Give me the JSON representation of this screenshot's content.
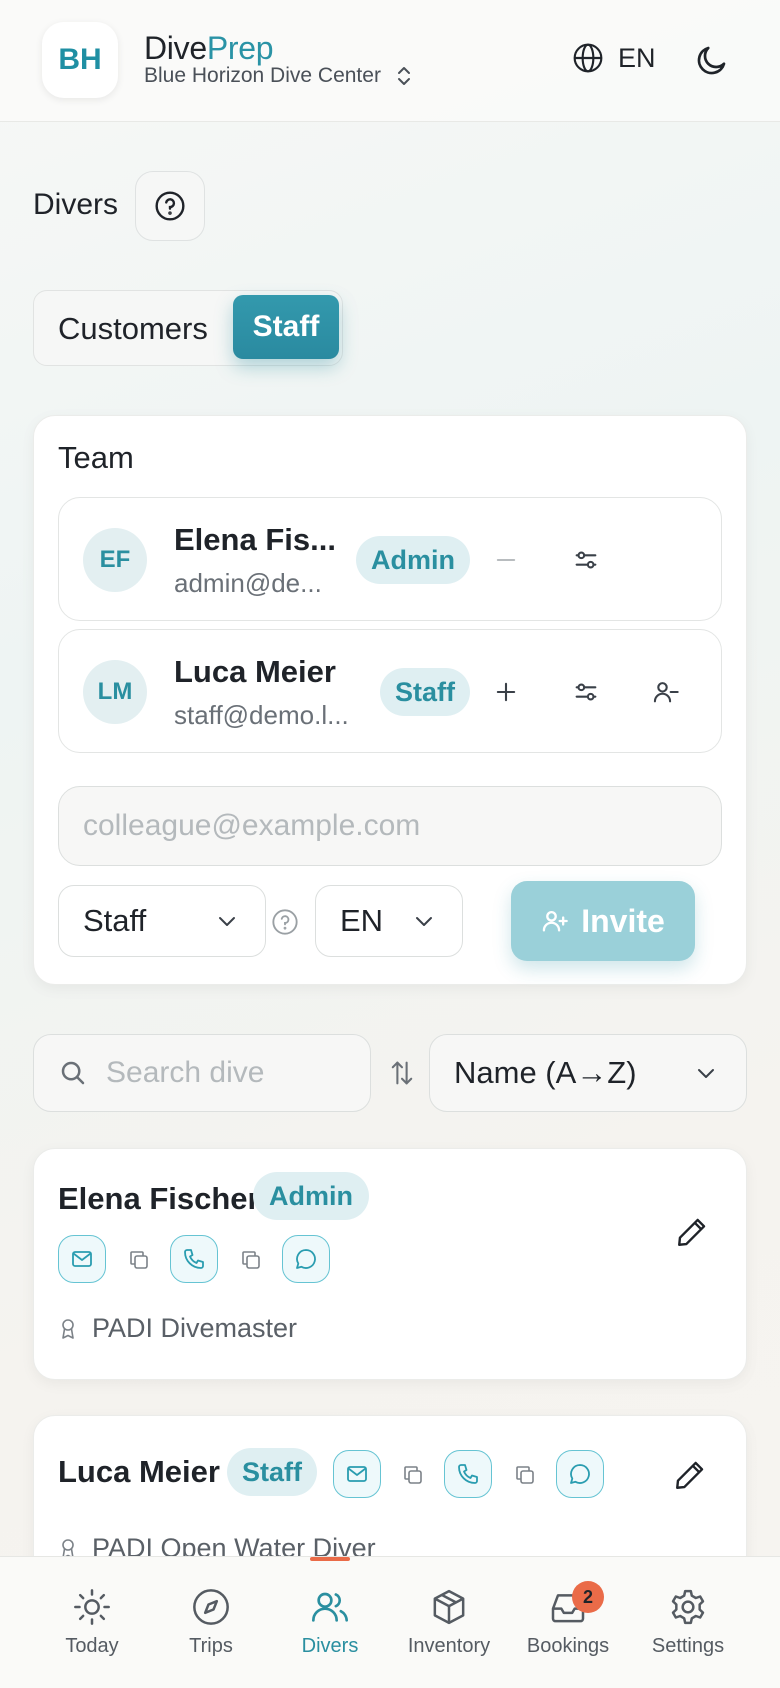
{
  "header": {
    "logo_initials": "BH",
    "brand_part1": "Dive",
    "brand_part2": "Prep",
    "center_name": "Blue Horizon Dive Center",
    "language": "EN"
  },
  "page": {
    "title": "Divers"
  },
  "segments": {
    "customers": "Customers",
    "staff": "Staff",
    "selected": "Staff"
  },
  "team": {
    "title": "Team",
    "members": [
      {
        "initials": "EF",
        "name": "Elena Fis...",
        "email": "admin@de...",
        "role": "Admin"
      },
      {
        "initials": "LM",
        "name": "Luca Meier",
        "email": "staff@demo.l...",
        "role": "Staff"
      }
    ],
    "invite": {
      "email_placeholder": "colleague@example.com",
      "role_value": "Staff",
      "language_value": "EN",
      "button_label": "Invite"
    }
  },
  "search": {
    "placeholder": "Search dive",
    "sort_value": "Name (A→Z)"
  },
  "divers": [
    {
      "name": "Elena Fischer",
      "role": "Admin",
      "certification": "PADI Divemaster"
    },
    {
      "name": "Luca Meier",
      "role": "Staff",
      "certification": "PADI Open Water Diver"
    }
  ],
  "nav": {
    "items": [
      {
        "label": "Today",
        "icon": "sun-icon"
      },
      {
        "label": "Trips",
        "icon": "compass-icon"
      },
      {
        "label": "Divers",
        "icon": "users-icon"
      },
      {
        "label": "Inventory",
        "icon": "box-icon"
      },
      {
        "label": "Bookings",
        "icon": "inbox-icon"
      },
      {
        "label": "Settings",
        "icon": "gear-icon"
      }
    ],
    "active": "Divers",
    "bookings_badge": "2"
  },
  "colors": {
    "accent": "#2a8fa0",
    "badge": "#ea6b48",
    "accent_light": "#dfeff2"
  }
}
